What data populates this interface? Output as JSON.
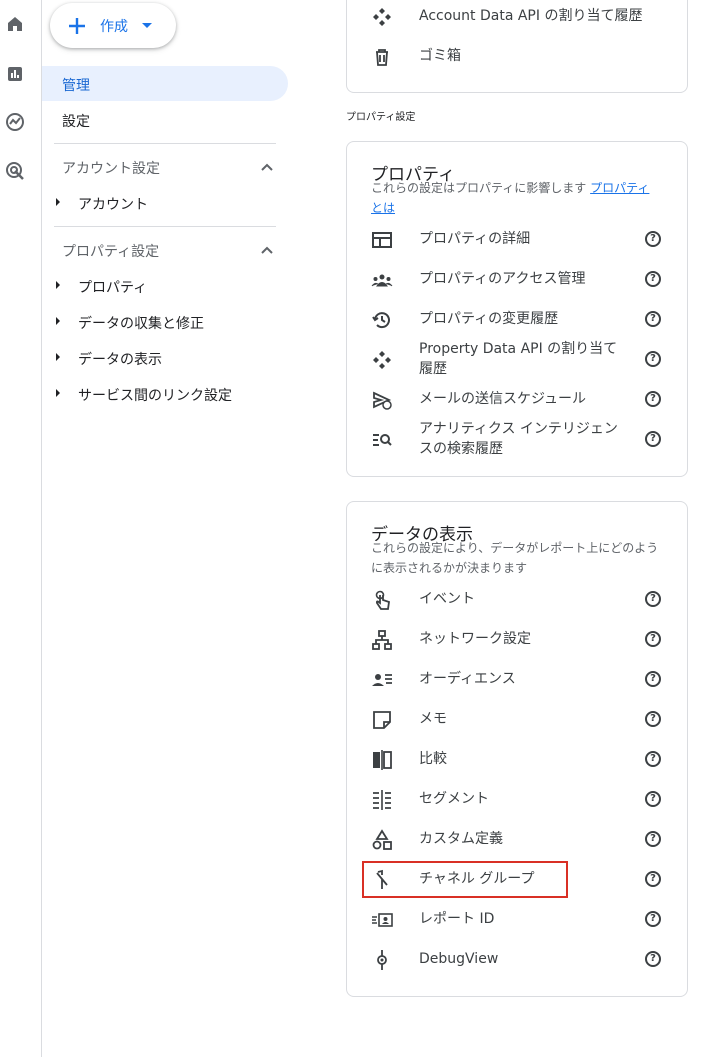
{
  "create_button": {
    "label": "作成"
  },
  "left_nav": {
    "admin": "管理",
    "settings": "設定",
    "account_section": {
      "title": "アカウント設定",
      "items": [
        "アカウント"
      ]
    },
    "property_section": {
      "title": "プロパティ設定",
      "items": [
        "プロパティ",
        "データの収集と修正",
        "データの表示",
        "サービス間のリンク設定"
      ]
    }
  },
  "top_card": {
    "items": [
      {
        "label": "Account Data API の割り当て履歴",
        "icon": "api-quota-icon"
      },
      {
        "label": "ゴミ箱",
        "icon": "trash-icon"
      }
    ]
  },
  "property_settings_heading": "プロパティ設定",
  "property_card": {
    "title": "プロパティ",
    "subtitle": "これらの設定はプロパティに影響します",
    "subtitle_link": "プロパティとは",
    "items": [
      {
        "label": "プロパティの詳細",
        "icon": "property-details-icon"
      },
      {
        "label": "プロパティのアクセス管理",
        "icon": "access-management-icon"
      },
      {
        "label": "プロパティの変更履歴",
        "icon": "history-icon"
      },
      {
        "label": "Property Data API の割り当て履歴",
        "icon": "api-quota-icon"
      },
      {
        "label": "メールの送信スケジュール",
        "icon": "scheduled-email-icon"
      },
      {
        "label": "アナリティクス インテリジェンスの検索履歴",
        "icon": "search-history-icon"
      }
    ]
  },
  "display_card": {
    "title": "データの表示",
    "subtitle": "これらの設定により、データがレポート上にどのように表示されるかが決まります",
    "items": [
      {
        "label": "イベント",
        "icon": "touch-icon"
      },
      {
        "label": "ネットワーク設定",
        "icon": "network-icon"
      },
      {
        "label": "オーディエンス",
        "icon": "audience-icon"
      },
      {
        "label": "メモ",
        "icon": "note-icon"
      },
      {
        "label": "比較",
        "icon": "compare-icon"
      },
      {
        "label": "セグメント",
        "icon": "segment-icon"
      },
      {
        "label": "カスタム定義",
        "icon": "shapes-icon"
      },
      {
        "label": "チャネル グループ",
        "icon": "merge-icon"
      },
      {
        "label": "レポート ID",
        "icon": "report-id-icon"
      },
      {
        "label": "DebugView",
        "icon": "debug-icon"
      }
    ]
  },
  "help_glyph": "?",
  "accent_color": "#1a73e8",
  "highlight_color": "#d93025"
}
